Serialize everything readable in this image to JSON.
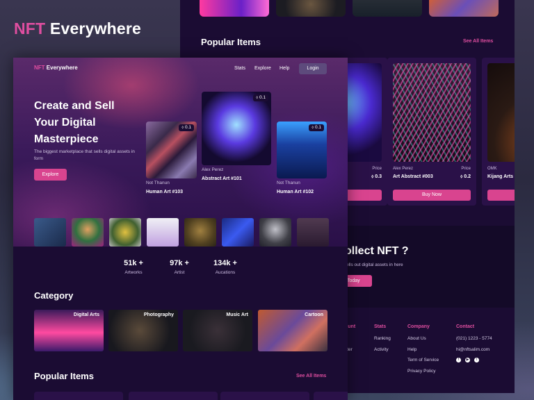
{
  "brand": {
    "prefix": "NFT",
    "suffix": "Everywhere"
  },
  "back": {
    "popular_title": "Popular Items",
    "see_all": "See All Items",
    "cards": [
      {
        "price_label": "Price",
        "price": "0.3",
        "buy": ""
      },
      {
        "creator": "Alex Perez",
        "name": "Art Abstract #003",
        "price_label": "Price",
        "price": "0.2",
        "buy": "Buy Now"
      },
      {
        "creator": "OMK",
        "name": "Kijang Arts",
        "buy": ""
      }
    ],
    "cta": {
      "title": "ollect NFT ?",
      "subtitle": "ells out digital assets in here",
      "button": "Today"
    },
    "footer": {
      "col0": {
        "heading": "ount",
        "items": [
          "n",
          "ster"
        ]
      },
      "col1": {
        "heading": "Stats",
        "items": [
          "Ranking",
          "Activity"
        ]
      },
      "col2": {
        "heading": "Company",
        "items": [
          "About Us",
          "Help",
          "Term of Service",
          "Privacy Policy"
        ]
      },
      "col3": {
        "heading": "Contact",
        "items": [
          "(021) 1223 - 5774",
          "hi@nftsalim.com"
        ]
      }
    }
  },
  "front": {
    "nav": {
      "links": [
        "Stats",
        "Explore",
        "Help"
      ],
      "login": "Login"
    },
    "hero": {
      "title_lines": [
        "Create and Sell",
        "Your Digital",
        "Masterpiece"
      ],
      "subtitle": "The biggest marketplace that sells digital assets in form",
      "cta": "Explore"
    },
    "hero_cards": [
      {
        "badge": "⬨ 0.1",
        "creator": "Not Thanun",
        "name": "Human Art #103"
      },
      {
        "badge": "⬨ 0.1",
        "creator": "Alex Perez",
        "name": "Abstract Art #101"
      },
      {
        "badge": "⬨ 0.1",
        "creator": "Not Thanun",
        "name": "Human Art #102"
      }
    ],
    "stats": [
      {
        "value": "51k +",
        "label": "Artworks"
      },
      {
        "value": "97k +",
        "label": "Artist"
      },
      {
        "value": "134k +",
        "label": "Aucations"
      }
    ],
    "category_title": "Category",
    "categories": [
      "Digital Arts",
      "Photography",
      "Music Art",
      "Cartoon"
    ],
    "popular_title": "Popular Items",
    "see_all": "See All Items"
  }
}
